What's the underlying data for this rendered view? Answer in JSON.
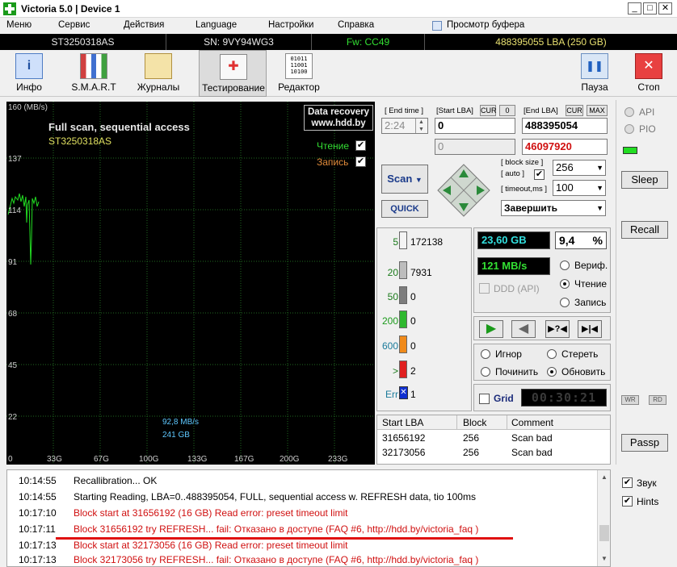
{
  "window": {
    "title": "Victoria 5.0 | Device 1",
    "min": "_",
    "max": "□",
    "close": "✕"
  },
  "menu": [
    "Меню",
    "Сервис",
    "Действия",
    "Language",
    "Настройки",
    "Справка"
  ],
  "buffer_view": "Просмотр буфера",
  "device": {
    "model": "ST3250318AS",
    "serial": "SN: 9VY94WG3",
    "firmware": "Fw: CC49",
    "capacity": "488395055 LBA (250 GB)"
  },
  "toolbar": {
    "left": [
      {
        "label": "Инфо",
        "icon": "info-icon"
      },
      {
        "label": "S.M.A.R.T",
        "icon": "smart-icon"
      },
      {
        "label": "Журналы",
        "icon": "journal-icon"
      },
      {
        "label": "Тестирование",
        "icon": "test-kit-icon"
      },
      {
        "label": "Редактор",
        "icon": "binary-editor-icon"
      }
    ],
    "editor_glyph": "01011\n11001\n10100",
    "pause": "Пауза",
    "stop": "Стоп"
  },
  "graph": {
    "ylabels": [
      "160 (MB/s)",
      "137",
      "114",
      "91",
      "68",
      "45",
      "22"
    ],
    "xlabels": [
      "0",
      "33G",
      "67G",
      "100G",
      "133G",
      "167G",
      "200G",
      "233G"
    ],
    "title": "Full scan, sequential access",
    "model": "ST3250318AS",
    "recovery1": "Data recovery",
    "recovery2": "www.hdd.by",
    "read_label": "Чтение",
    "write_label": "Запись",
    "speed": "92,8 MB/s",
    "position": "241 GB"
  },
  "scan": {
    "end_time_label": "[ End time ]",
    "end_time": "2:24",
    "start_lba_label": "[Start LBA]",
    "cur": "CUR",
    "zero": "0",
    "end_lba_label": "[End LBA]",
    "end_cur": "CUR",
    "max": "MAX",
    "start_lba": "0",
    "end_lba": "488395054",
    "cur_lba": "0",
    "cur_lba_red": "46097920",
    "block_size_label": "[ block size ]",
    "auto_label": "[ auto ]",
    "timeout_label": "[ timeout,ms ]",
    "block_size": "256",
    "timeout": "100",
    "scan_btn": "Scan",
    "quick_btn": "QUICK",
    "finish": "Завершить"
  },
  "blocks": [
    {
      "label": "5",
      "count": "172138",
      "color": "#f4f4f4",
      "lc": "#1a7a1a"
    },
    {
      "label": "20",
      "count": "7931",
      "color": "#bdbdbd",
      "lc": "#1a7a1a"
    },
    {
      "label": "50",
      "count": "0",
      "color": "#7d7d7d",
      "lc": "#1a7a1a"
    },
    {
      "label": "200",
      "count": "0",
      "color": "#2fb82f",
      "lc": "#1a9a1a"
    },
    {
      "label": "600",
      "count": "0",
      "color": "#f08a1a",
      "lc": "#1a7a9a"
    },
    {
      "label": ">",
      "count": "2",
      "color": "#e02020",
      "lc": "#1a7a1a"
    },
    {
      "label": "Err",
      "count": "1",
      "color": "#1030d0",
      "lc": "#1a7a9a"
    }
  ],
  "stats": {
    "done_gb": "23,60 GB",
    "percent": "9,4",
    "percent_sign": "%",
    "speed": "121 MB/s",
    "ddd_api": "DDD (API)",
    "verify": "Вериф.",
    "read": "Чтение",
    "write": "Запись",
    "ignore": "Игнор",
    "erase": "Стереть",
    "repair": "Починить",
    "refresh": "Обновить",
    "grid": "Grid",
    "timer": "00:30:21"
  },
  "table": {
    "headers": [
      "Start LBA",
      "Block",
      "Comment"
    ],
    "rows": [
      [
        "31656192",
        "256",
        "Scan bad"
      ],
      [
        "32173056",
        "256",
        "Scan bad"
      ]
    ]
  },
  "side": {
    "api": "API",
    "pio": "PIO",
    "sleep": "Sleep",
    "recall": "Recall",
    "wr": "WR",
    "rd": "RD",
    "passp": "Passp",
    "sound": "Звук",
    "hints": "Hints"
  },
  "log": [
    {
      "time": "10:14:55",
      "text": "Recallibration... OK",
      "color": "#000000"
    },
    {
      "time": "10:14:55",
      "text": "Starting Reading, LBA=0..488395054, FULL, sequential access w. REFRESH data, tio 100ms",
      "color": "#000000"
    },
    {
      "time": "10:17:10",
      "text": "Block start at 31656192 (16 GB) Read error: preset timeout limit",
      "color": "#d01010"
    },
    {
      "time": "10:17:11",
      "text": "Block 31656192 try REFRESH... fail: Отказано в доступе (FAQ #6, http://hdd.by/victoria_faq )",
      "color": "#d01010"
    },
    {
      "time": "10:17:13",
      "text": "Block start at 32173056 (16 GB) Read error: preset timeout limit",
      "color": "#d01010"
    },
    {
      "time": "10:17:13",
      "text": "Block 32173056 try REFRESH... fail: Отказано в доступе (FAQ #6, http://hdd.by/victoria_faq )",
      "color": "#d01010"
    }
  ],
  "colors": {
    "accent_green": "#00e000",
    "graph_bg": "#000000",
    "error_red": "#d01010"
  }
}
